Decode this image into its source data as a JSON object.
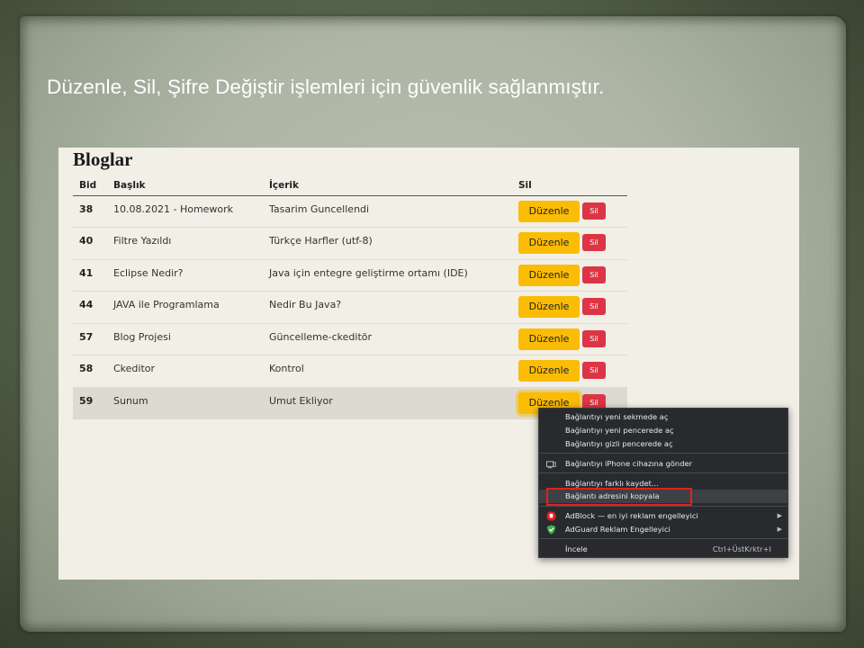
{
  "slide": {
    "heading": "Düzenle, Sil, Şifre Değiştir işlemleri için güvenlik sağlanmıştır."
  },
  "page": {
    "title": "Bloglar",
    "columns": [
      "Bid",
      "Başlık",
      "İçerik",
      "Sil"
    ],
    "edit_label": "Düzenle",
    "delete_label": "Sil",
    "rows": [
      {
        "bid": "38",
        "title": "10.08.2021 - Homework",
        "content": "Tasarim Guncellendi"
      },
      {
        "bid": "40",
        "title": "Filtre Yazıldı",
        "content": "Türkçe Harfler (utf-8)"
      },
      {
        "bid": "41",
        "title": "Eclipse Nedir?",
        "content": "Java için entegre geliştirme ortamı (IDE)"
      },
      {
        "bid": "44",
        "title": "JAVA ile Programlama",
        "content": "Nedir Bu Java?"
      },
      {
        "bid": "57",
        "title": "Blog Projesi",
        "content": "Güncelleme-ckeditör"
      },
      {
        "bid": "58",
        "title": "Ckeditor",
        "content": "Kontrol"
      },
      {
        "bid": "59",
        "title": "Sunum",
        "content": "Umut Ekliyor"
      }
    ]
  },
  "context_menu": {
    "items": [
      "Bağlantıyı yeni sekmede aç",
      "Bağlantıyı yeni pencerede aç",
      "Bağlantıyı gizli pencerede aç",
      "Bağlantıyı iPhone cihazına gönder",
      "Bağlantıyı farklı kaydet...",
      "Bağlantı adresini kopyala",
      "AdBlock — en iyi reklam engelleyici",
      "AdGuard Reklam Engelleyici",
      "İncele"
    ],
    "inspect_shortcut": "Ctrl+ÜstKrktr+I",
    "adblock_color": "#e02020",
    "adguard_color": "#3db24b",
    "highlight_color": "#e02020"
  }
}
